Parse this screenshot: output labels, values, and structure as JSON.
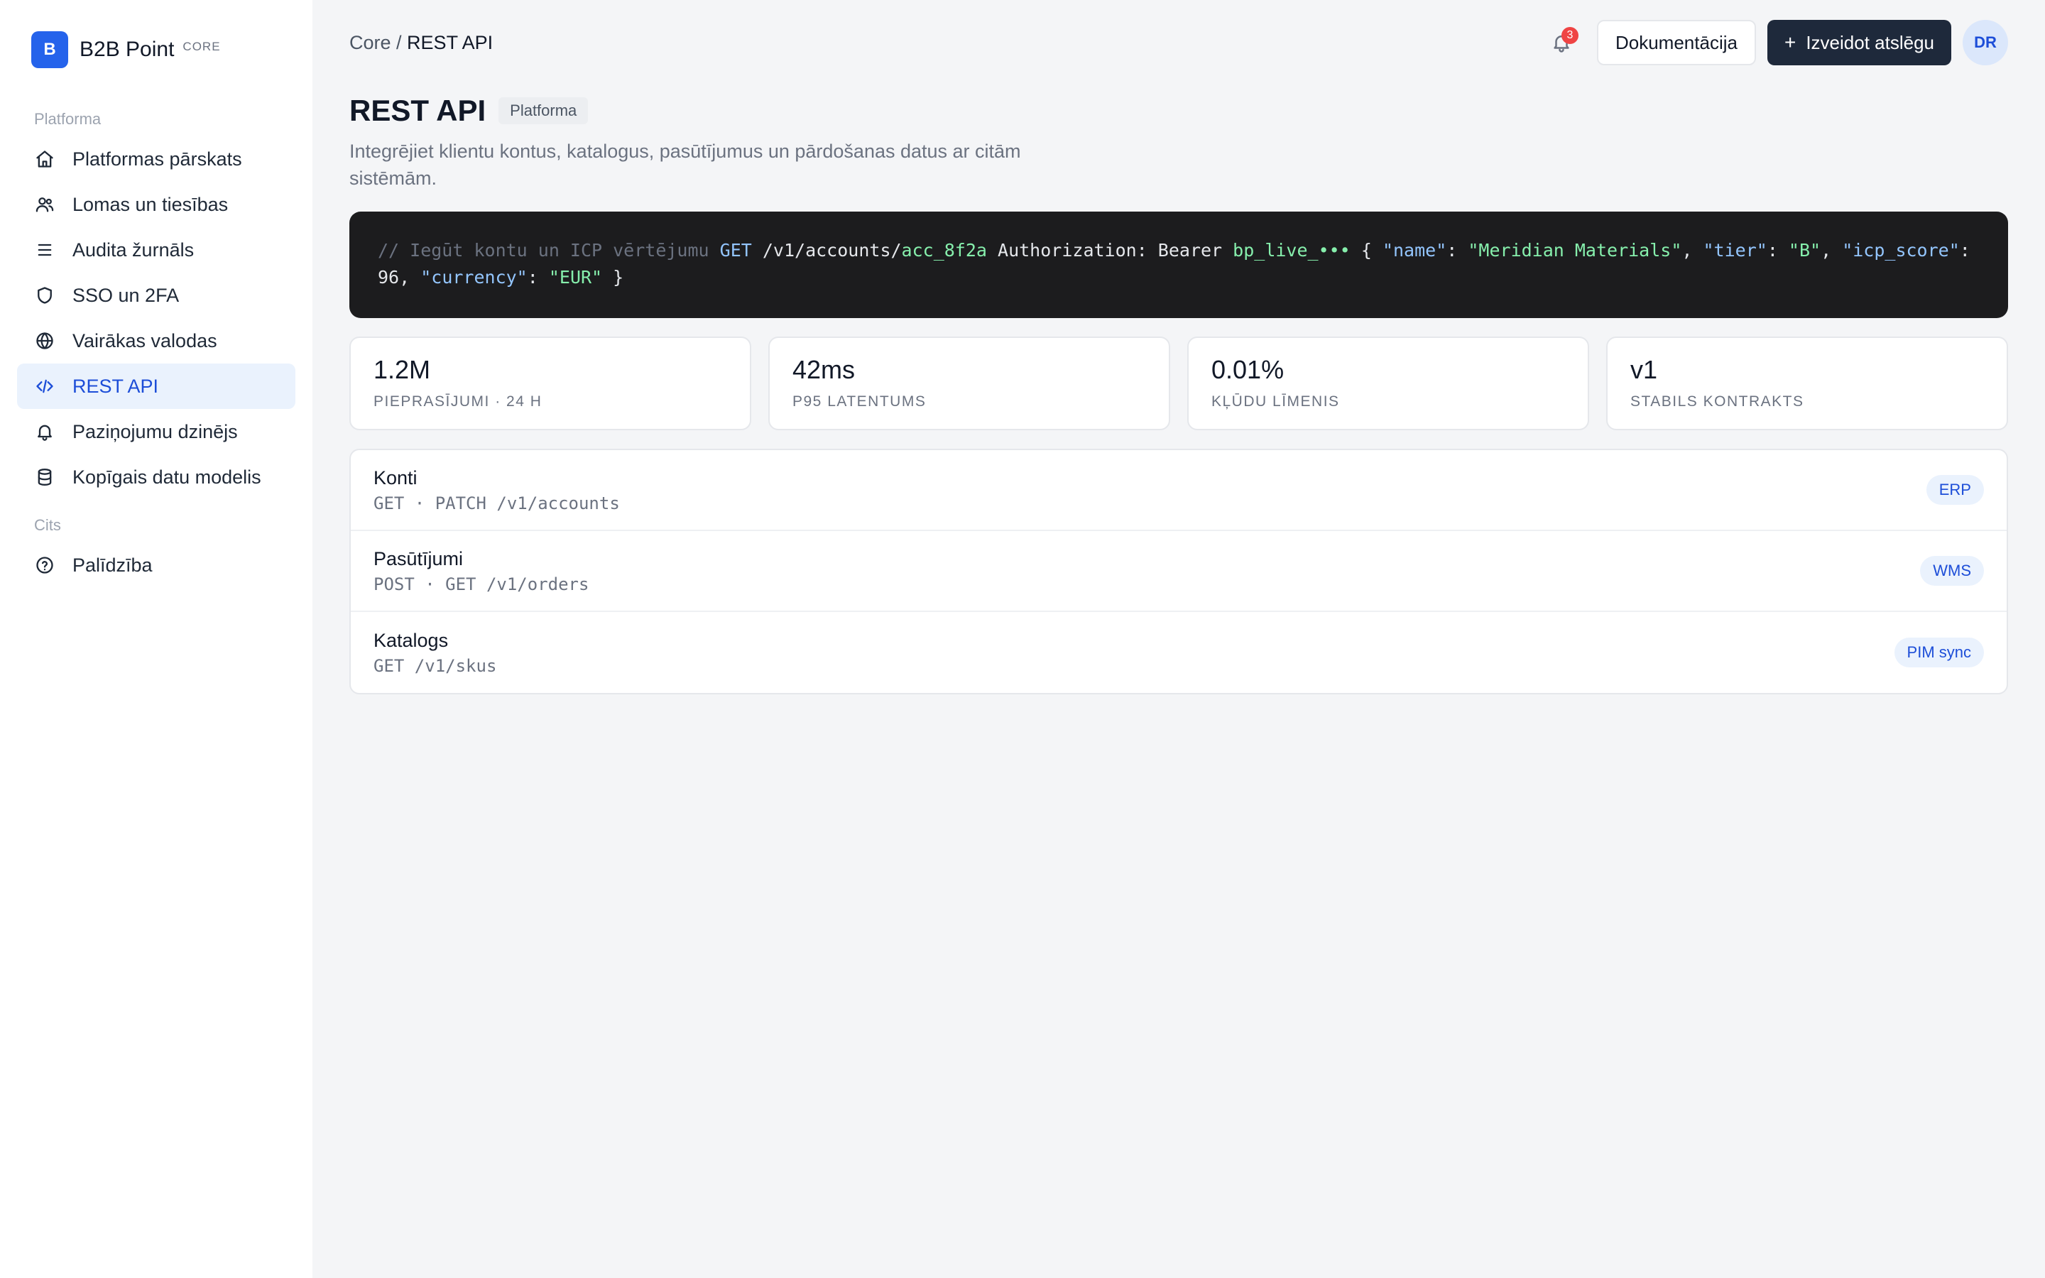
{
  "brand": {
    "logo_letter": "B",
    "name": "B2B Point",
    "tag": "CORE"
  },
  "sidebar": {
    "sections": [
      {
        "title": "Platforma",
        "items": [
          {
            "label": "Platformas pārskats",
            "icon": "home-icon"
          },
          {
            "label": "Lomas un tiesības",
            "icon": "users-icon"
          },
          {
            "label": "Audita žurnāls",
            "icon": "list-icon"
          },
          {
            "label": "SSO un 2FA",
            "icon": "shield-icon"
          },
          {
            "label": "Vairākas valodas",
            "icon": "globe-icon"
          },
          {
            "label": "REST API",
            "icon": "code-icon",
            "active": true
          },
          {
            "label": "Paziņojumu dzinējs",
            "icon": "bell-icon"
          },
          {
            "label": "Kopīgais datu modelis",
            "icon": "database-icon"
          }
        ]
      },
      {
        "title": "Cits",
        "items": [
          {
            "label": "Palīdzība",
            "icon": "help-circle-icon"
          }
        ]
      }
    ]
  },
  "header": {
    "breadcrumb_root": "Core",
    "breadcrumb_sep": " / ",
    "breadcrumb_current": "REST API",
    "notifications_count": "3",
    "docs_button": "Dokumentācija",
    "create_key_button": "Izveidot atslēgu",
    "avatar_initials": "DR"
  },
  "page": {
    "title": "REST API",
    "chip": "Platforma",
    "subtitle": "Integrējiet klientu kontus, katalogus, pasūtījumus un pārdošanas datus ar citām sistēmām."
  },
  "code": {
    "comment": "// Iegūt kontu un ICP vērtējumu",
    "method": "GET",
    "path": "/v1/accounts/",
    "path_id": "acc_8f2a",
    "auth_label": "Authorization: Bearer",
    "token": "bp_live_•••",
    "brace_open": "{",
    "k_name": "\"name\"",
    "v_name": "\"Meridian Materials\"",
    "k_tier": "\"tier\"",
    "v_tier": "\"B\"",
    "k_icp": "\"icp_score\"",
    "v_icp": "96",
    "k_currency": "\"currency\"",
    "v_currency": "\"EUR\"",
    "brace_close": "}"
  },
  "stats": [
    {
      "value": "1.2M",
      "label": "Pieprasījumi · 24 h"
    },
    {
      "value": "42ms",
      "label": "P95 latentums"
    },
    {
      "value": "0.01%",
      "label": "Kļūdu līmenis"
    },
    {
      "value": "v1",
      "label": "Stabils kontrakts"
    }
  ],
  "endpoints": [
    {
      "name": "Konti",
      "route": "GET · PATCH /v1/accounts",
      "badge": "ERP"
    },
    {
      "name": "Pasūtījumi",
      "route": "POST · GET /v1/orders",
      "badge": "WMS"
    },
    {
      "name": "Katalogs",
      "route": "GET /v1/skus",
      "badge": "PIM sync"
    }
  ],
  "colors": {
    "accent": "#2563eb",
    "primary_button": "#1e293b",
    "active_nav_bg": "#eaf2fd",
    "badge_red": "#ef4444",
    "code_bg": "#1c1c1e"
  }
}
